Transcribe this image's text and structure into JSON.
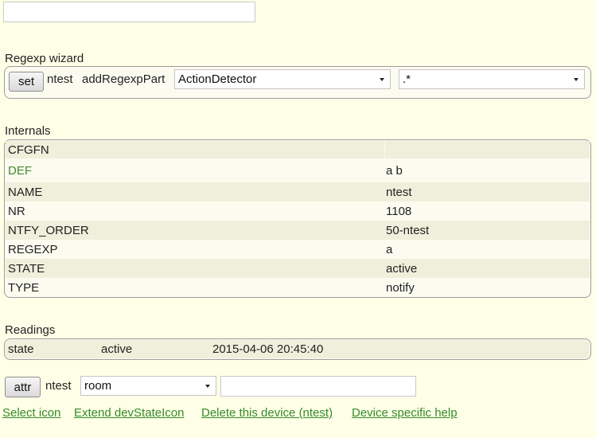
{
  "top_input": {
    "value": ""
  },
  "regexp_wizard": {
    "title": "Regexp wizard",
    "set_button": "set",
    "device": "ntest",
    "command": "addRegexpPart",
    "device_select": "ActionDetector",
    "regex_select": ".*"
  },
  "internals": {
    "title": "Internals",
    "rows": [
      {
        "key": "CFGFN",
        "value": ""
      },
      {
        "key": "DEF",
        "value": "a b"
      },
      {
        "key": "NAME",
        "value": "ntest"
      },
      {
        "key": "NR",
        "value": "1108"
      },
      {
        "key": "NTFY_ORDER",
        "value": "50-ntest"
      },
      {
        "key": "REGEXP",
        "value": "a"
      },
      {
        "key": "STATE",
        "value": "active"
      },
      {
        "key": "TYPE",
        "value": "notify"
      }
    ]
  },
  "readings": {
    "title": "Readings",
    "rows": [
      {
        "name": "state",
        "value": "active",
        "time": "2015-04-06 20:45:40"
      }
    ]
  },
  "attr": {
    "button": "attr",
    "device": "ntest",
    "select": "room",
    "value": ""
  },
  "links": {
    "select_icon": "Select icon",
    "extend_icon": "Extend devStateIcon",
    "delete_device": "Delete this device (ntest)",
    "device_help": "Device specific help"
  },
  "colors": {
    "background": "#ffffe7",
    "link": "#348b2a",
    "def_key": "#468a2b",
    "row_stripe": "#f0efdb"
  }
}
